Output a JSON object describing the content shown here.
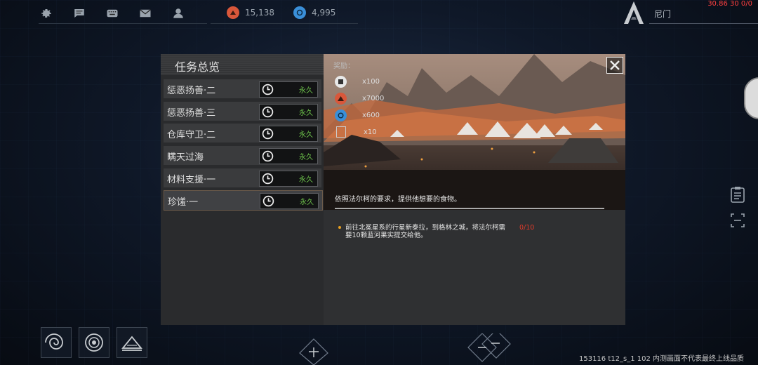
{
  "topbar": {
    "icons": [
      "settings-icon",
      "chat-icon",
      "keyboard-icon",
      "mail-icon",
      "user-icon"
    ],
    "resource1": {
      "value": "15,138",
      "color": "#d9573a"
    },
    "resource2": {
      "value": "4,995",
      "color": "#3a8fd9"
    },
    "nickname": "尼门",
    "debug": "30.86 30 0/0"
  },
  "panel": {
    "title": "任务总览",
    "tasks": [
      {
        "name": "惩恶扬善·二",
        "duration": "永久"
      },
      {
        "name": "惩恶扬善·三",
        "duration": "永久"
      },
      {
        "name": "仓库守卫·二",
        "duration": "永久"
      },
      {
        "name": "瞒天过海",
        "duration": "永久"
      },
      {
        "name": "材料支援·一",
        "duration": "永久"
      },
      {
        "name": "珍馐·一",
        "duration": "永久"
      }
    ],
    "selected_index": 5
  },
  "detail": {
    "reward_label": "奖励：",
    "rewards": [
      {
        "icon": "chip-icon",
        "amount": "x100",
        "color": "#e8e8e8"
      },
      {
        "icon": "credits-icon",
        "amount": "x7000",
        "color": "#d9573a"
      },
      {
        "icon": "crystal-icon",
        "amount": "x600",
        "color": "#3a8fd9"
      },
      {
        "icon": "crate-icon",
        "amount": "x10",
        "color": "#cccccc"
      }
    ],
    "description": "依照法尔柯的要求，提供他想要的食物。",
    "objective": "前往北冕星系的行星新泰拉，到格林之城，将法尔柯需要10颗蓝河果实提交给他。",
    "objective_progress": "0/10"
  },
  "footer": "153116 t12_s_1 102  内测画面不代表最终上线品质"
}
